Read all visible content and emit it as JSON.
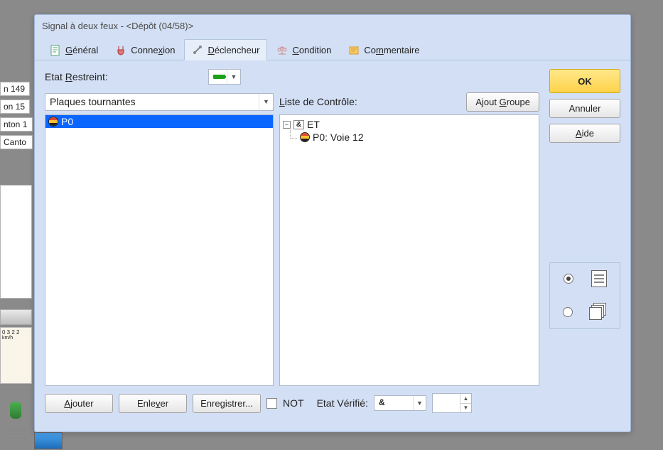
{
  "dialog": {
    "title": "Signal à deux feux  -  <Dépôt (04/58)>"
  },
  "tabs": {
    "general": {
      "prefix": "",
      "u": "G",
      "rest": "énéral"
    },
    "connection": {
      "prefix": " Conne",
      "u": "x",
      "rest": "ion"
    },
    "trigger": {
      "prefix": " ",
      "u": "D",
      "rest": "éclencheur"
    },
    "condition": {
      "prefix": "",
      "u": "C",
      "rest": "ondition"
    },
    "comment": {
      "prefix": "Co",
      "u": "m",
      "rest": "mentaire"
    }
  },
  "labels": {
    "etat_restreint_pre": "Etat ",
    "etat_restreint_u": "R",
    "etat_restreint_post": "estreint:",
    "liste_controle_u": "L",
    "liste_controle_post": "iste de Contrôle:",
    "ajout_groupe_pre": "Ajout ",
    "ajout_groupe_u": "G",
    "ajout_groupe_post": "roupe",
    "not": "NOT",
    "etat_verifie": "Etat Vérifié:"
  },
  "dropdowns": {
    "plaques": "Plaques tournantes",
    "etat_verifie_value": "&"
  },
  "listbox": {
    "items": [
      {
        "label": "P0"
      }
    ]
  },
  "tree": {
    "root": {
      "label": "ET"
    },
    "child": {
      "label": "P0: Voie 12"
    }
  },
  "bottom_buttons": {
    "ajouter_u": "A",
    "ajouter_post": "jouter",
    "enlever_pre": "Enle",
    "enlever_u": "v",
    "enlever_post": "er",
    "enregistrer": "Enregistrer..."
  },
  "sidebar": {
    "ok": "OK",
    "annuler": "Annuler",
    "aide_u": "A",
    "aide_post": "ide"
  },
  "bg": {
    "i1": "n 149",
    "i2": "on 15",
    "i3": "nton 1",
    "i4": "Canto",
    "gauge1": "0 3 2 2",
    "gauge2": "km/h"
  }
}
